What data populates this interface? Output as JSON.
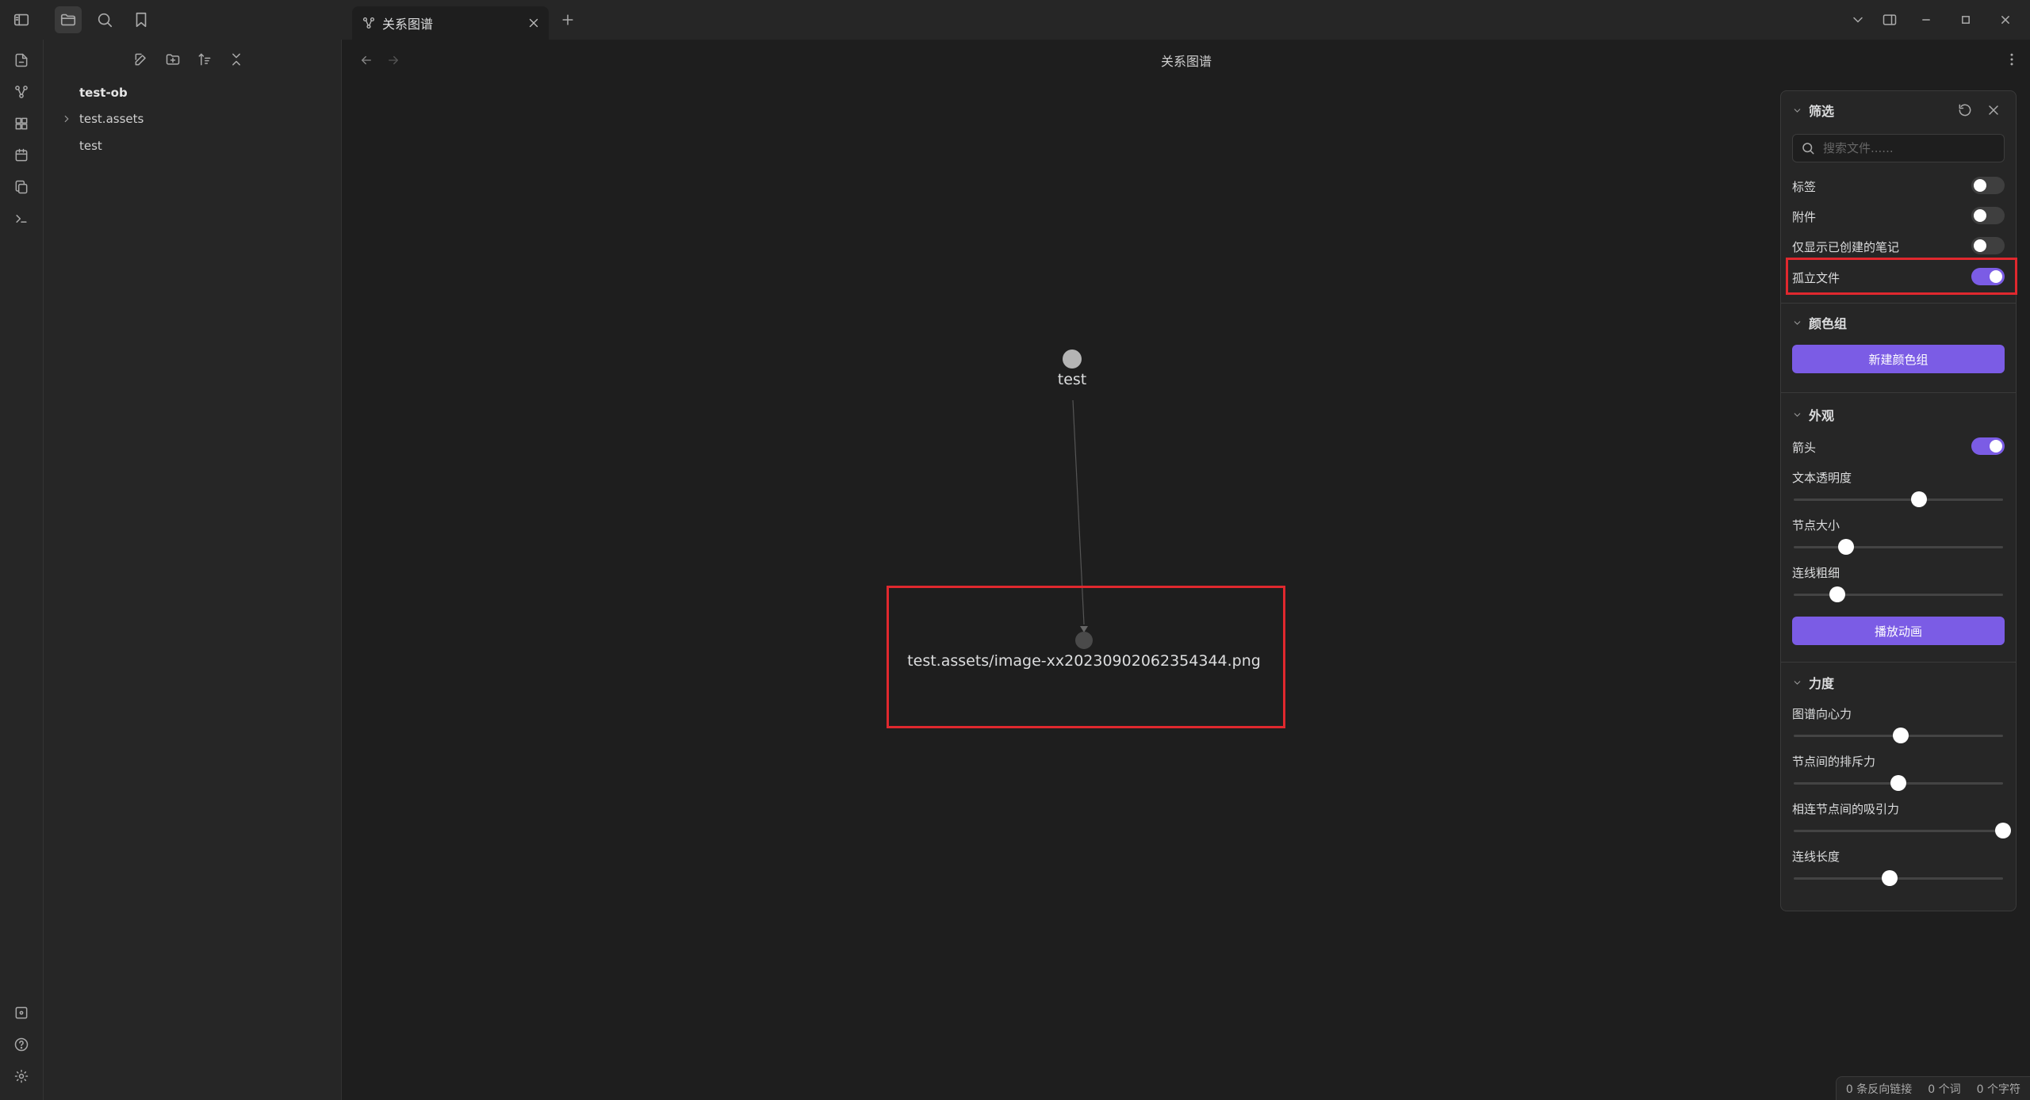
{
  "tab": {
    "label": "关系图谱",
    "icon": "graph-icon"
  },
  "view": {
    "title": "关系图谱"
  },
  "sidebar": {
    "vault_name": "test-ob",
    "items": [
      {
        "label": "test.assets",
        "type": "folder"
      },
      {
        "label": "test",
        "type": "file"
      }
    ]
  },
  "graph": {
    "nodes": [
      {
        "label": "test",
        "color": "#b4b4b4"
      },
      {
        "label": "test.assets/image-xx20230902062354344.png",
        "color": "#4a4a4a"
      }
    ]
  },
  "panel": {
    "filter": {
      "title": "筛选",
      "search_placeholder": "搜索文件......",
      "toggles": [
        {
          "label": "标签",
          "on": false
        },
        {
          "label": "附件",
          "on": false
        },
        {
          "label": "仅显示已创建的笔记",
          "on": false
        },
        {
          "label": "孤立文件",
          "on": true
        }
      ]
    },
    "groups": {
      "title": "颜色组",
      "button": "新建颜色组"
    },
    "display": {
      "title": "外观",
      "arrows_label": "箭头",
      "arrows_on": true,
      "sliders": [
        {
          "label": "文本透明度",
          "value": 0.6
        },
        {
          "label": "节点大小",
          "value": 0.25
        },
        {
          "label": "连线粗细",
          "value": 0.21
        }
      ],
      "animate_button": "播放动画"
    },
    "forces": {
      "title": "力度",
      "sliders": [
        {
          "label": "图谱向心力",
          "value": 0.51
        },
        {
          "label": "节点间的排斥力",
          "value": 0.5
        },
        {
          "label": "相连节点间的吸引力",
          "value": 1.0
        },
        {
          "label": "连线长度",
          "value": 0.46
        }
      ]
    }
  },
  "status": {
    "backlinks": "0 条反向链接",
    "words": "0 个词",
    "chars": "0 个字符"
  },
  "colors": {
    "accent": "#7b5ce5",
    "highlight": "#e0282e"
  }
}
